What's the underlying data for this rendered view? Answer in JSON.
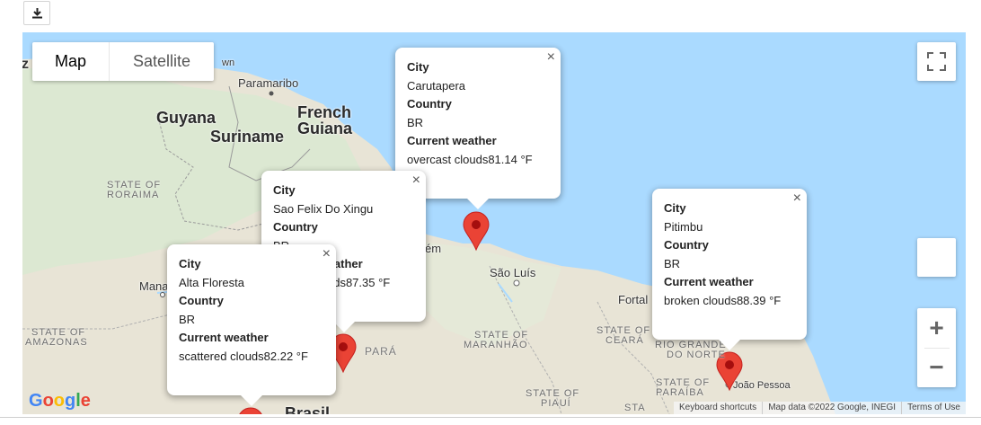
{
  "toolbar": {
    "download_icon": "download-icon"
  },
  "map": {
    "type_control": {
      "map_label": "Map",
      "satellite_label": "Satellite"
    },
    "fullscreen_icon": "fullscreen-icon",
    "zoom": {
      "in_label": "+",
      "out_label": "−"
    },
    "labels": {
      "countries": [
        "Guyana",
        "Suriname",
        "French",
        "Guiana",
        "Brasil"
      ],
      "states": [
        "STATE OF",
        "RORAIMA",
        "STATE OF",
        "AMAZONAS",
        "STATE OF",
        "MARANHÃO",
        "STATE OF",
        "PIAUÍ",
        "STATE OF",
        "CEARÁ",
        "RIO GRANDE",
        "DO NORTE",
        "STATE OF",
        "PARAÍBA",
        "PARÁ",
        "STA"
      ],
      "cities": [
        "Paramaribo",
        "São Luís",
        "Fortal",
        "João Pessoa",
        "Mana",
        "wn",
        "ém",
        "z"
      ]
    },
    "popups": [
      {
        "city_header": "City",
        "city": "Carutapera",
        "country_header": "Country",
        "country": "BR",
        "weather_header": "Current weather",
        "weather": "overcast clouds81.14 °F",
        "close": "×"
      },
      {
        "city_header": "City",
        "city": "Sao Felix Do Xingu",
        "country_header": "Country",
        "country": "BR",
        "weather_header": "Current weather",
        "weather": "broken clouds87.35 °F",
        "close": "×"
      },
      {
        "city_header": "City",
        "city": "Alta Floresta",
        "country_header": "Country",
        "country": "BR",
        "weather_header": "Current weather",
        "weather": "scattered clouds82.22 °F",
        "close": "×"
      },
      {
        "city_header": "City",
        "city": "Pitimbu",
        "country_header": "Country",
        "country": "BR",
        "weather_header": "Current weather",
        "weather": "broken clouds88.39 °F",
        "close": "×"
      }
    ],
    "attribution": {
      "logo": "Google",
      "shortcuts": "Keyboard shortcuts",
      "data": "Map data ©2022 Google, INEGI",
      "terms": "Terms of Use"
    },
    "colors": {
      "water": "#aadaff",
      "land": "#e8e4d6",
      "marker": "#ea4335"
    }
  }
}
